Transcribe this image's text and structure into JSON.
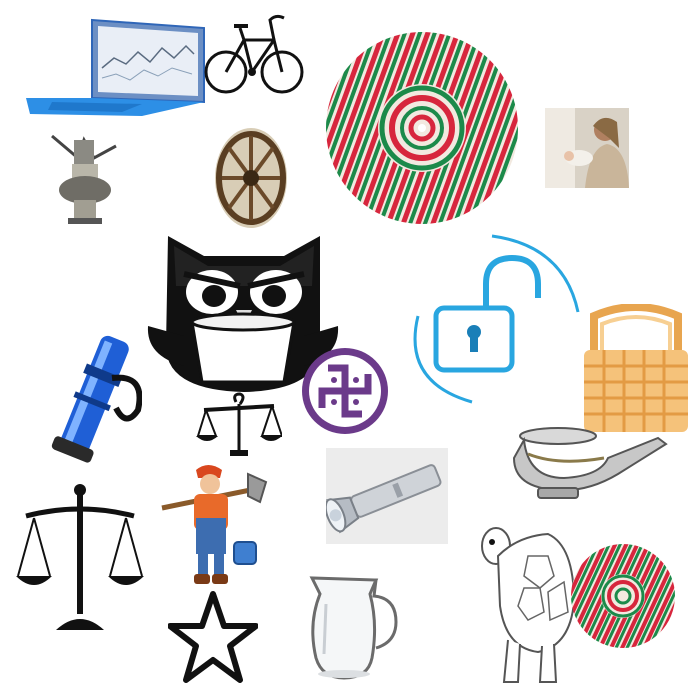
{
  "canvas": {
    "background": "#ffffff"
  },
  "items": [
    {
      "icon": "laptop-icon"
    },
    {
      "icon": "bicycle-icon"
    },
    {
      "icon": "woven-basket-plate-icon"
    },
    {
      "icon": "mother-and-baby-photo"
    },
    {
      "icon": "oil-lamp-icon"
    },
    {
      "icon": "wagon-wheel-photo"
    },
    {
      "icon": "owl-with-cup-icon"
    },
    {
      "icon": "unlock-padlock-icon"
    },
    {
      "icon": "wicker-basket-icon"
    },
    {
      "icon": "flashlight-blue-icon"
    },
    {
      "icon": "balance-scale-small-icon"
    },
    {
      "icon": "swastika-symbol-icon"
    },
    {
      "icon": "aladdin-lamp-icon"
    },
    {
      "icon": "balance-scale-large-icon"
    },
    {
      "icon": "woodcutter-boy-icon"
    },
    {
      "icon": "flashlight-silver-photo"
    },
    {
      "icon": "tortoise-outline-icon"
    },
    {
      "icon": "woven-basket-plate-small-icon"
    },
    {
      "icon": "star-outline-icon"
    },
    {
      "icon": "glass-jug-icon"
    }
  ],
  "colors": {
    "owl": "#111111",
    "lock": "#29a6e0",
    "symbol": "#6b3a8a",
    "basket": "#f5c27a",
    "plate_red": "#d7263d",
    "plate_green": "#1c8a4a"
  }
}
